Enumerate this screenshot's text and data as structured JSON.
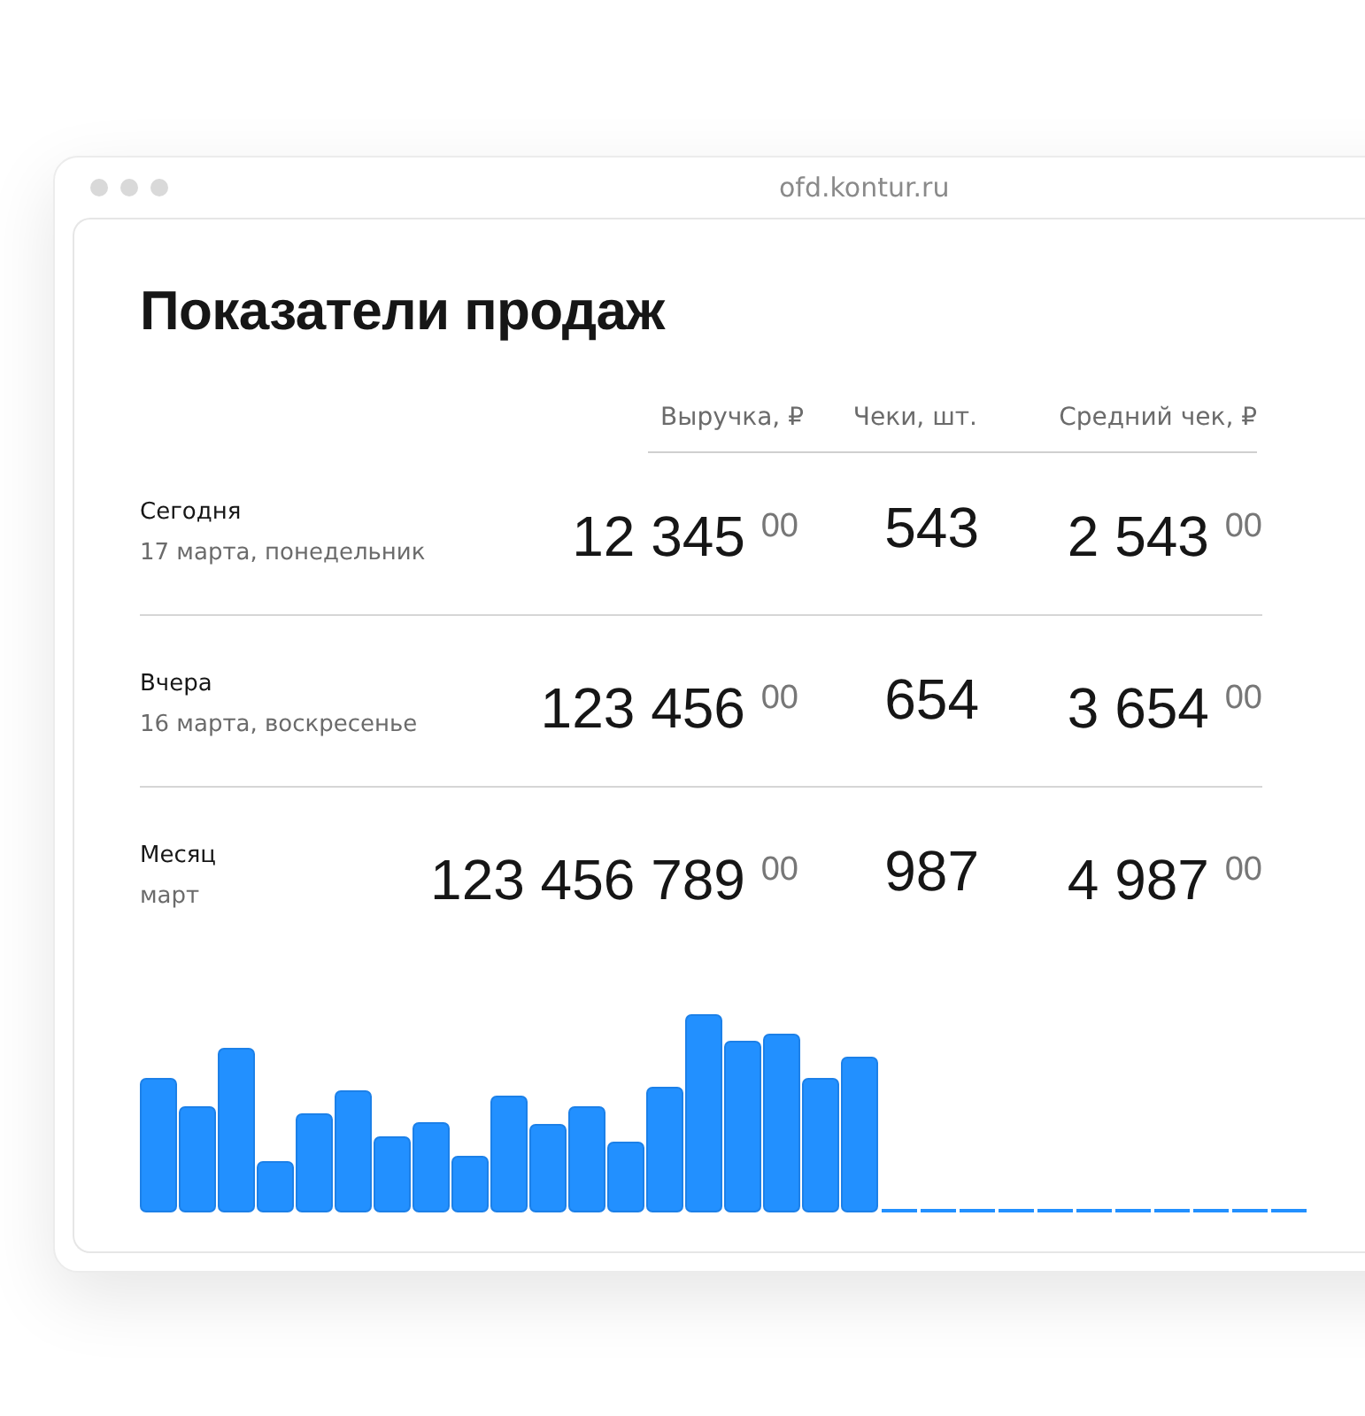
{
  "browser": {
    "address": "ofd.kontur.ru"
  },
  "title": "Показатели продаж",
  "columns": [
    "Выручка, ₽",
    "Чеки, шт.",
    "Средний чек, ₽"
  ],
  "rows": [
    {
      "period": "Сегодня",
      "date": "17 марта, понедельник",
      "revenue": {
        "main": "12 345",
        "fraction": "00"
      },
      "checks": "543",
      "average": {
        "main": "2 543",
        "fraction": "00"
      }
    },
    {
      "period": "Вчера",
      "date": "16 марта, воскресенье",
      "revenue": {
        "main": "123 456",
        "fraction": "00"
      },
      "checks": "654",
      "average": {
        "main": "3 654",
        "fraction": "00"
      }
    },
    {
      "period": "Месяц",
      "date": "март",
      "revenue": {
        "main": "123 456 789",
        "fraction": "00"
      },
      "checks": "987",
      "average": {
        "main": "4 987",
        "fraction": "00"
      }
    }
  ]
}
